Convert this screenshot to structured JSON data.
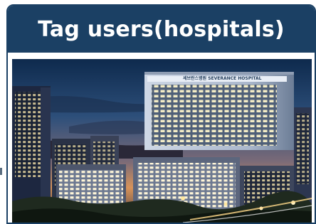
{
  "card": {
    "title": "Tag users(hospitals)"
  },
  "photo": {
    "subject": "hospital-building-night-photo",
    "building_sign": "세브란스병원 SEVERANCE HOSPITAL"
  },
  "colors": {
    "header_bg": "#1b4064",
    "header_text": "#ffffff",
    "border": "#1b4064"
  }
}
